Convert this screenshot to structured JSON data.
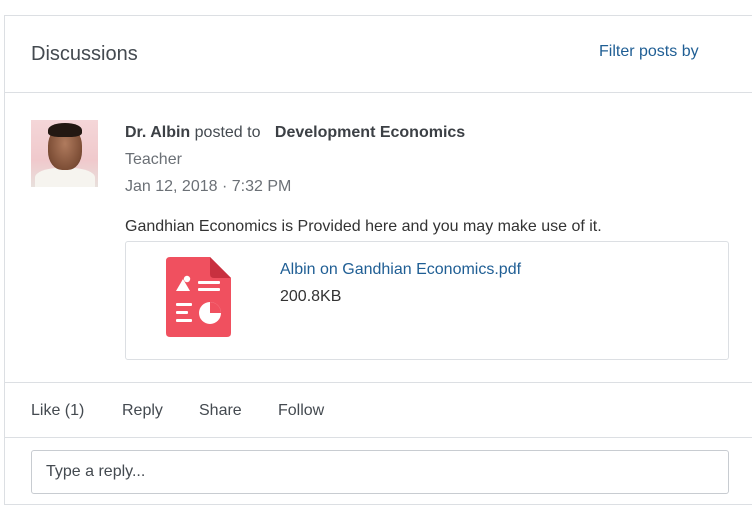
{
  "header": {
    "title": "Discussions",
    "filter_label": "Filter posts by"
  },
  "post": {
    "avatar_icon": "user-avatar",
    "author": "Dr. Albin",
    "posted_to_text": "posted to",
    "course": "Development Economics",
    "role": "Teacher",
    "timestamp": "Jan 12, 2018 · 7:32 PM",
    "body": "Gandhian Economics is Provided here and you may make use of it.",
    "attachment": {
      "icon": "pdf-file-icon",
      "icon_color": "#f0505f",
      "file_name": "Albin on Gandhian Economics.pdf",
      "file_size": "200.8KB"
    }
  },
  "actions": {
    "like_label": "Like (1)",
    "reply_label": "Reply",
    "share_label": "Share",
    "follow_label": "Follow"
  },
  "reply": {
    "placeholder": "Type a reply..."
  },
  "colors": {
    "link": "#1f5e94",
    "border": "#dcdfe3"
  }
}
